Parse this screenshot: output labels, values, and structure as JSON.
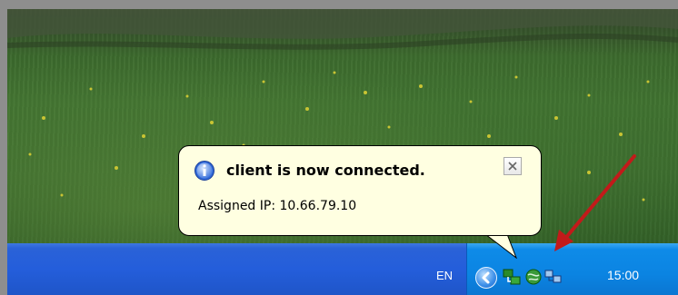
{
  "balloon": {
    "title": "client is now connected.",
    "message": "Assigned IP: 10.66.79.10",
    "icon": "info-icon",
    "close_icon": "close-icon"
  },
  "taskbar": {
    "language": "EN",
    "clock": "15:00",
    "show_hidden_icon": "chevron-left-icon",
    "tray_icons": [
      "network-connection-icon",
      "globe-network-icon",
      "network-computers-icon"
    ]
  },
  "colors": {
    "taskbar_blue": "#245edb",
    "tray_blue": "#0b84e2",
    "balloon_bg": "#ffffe1",
    "annotation_arrow": "#c21a1a"
  }
}
